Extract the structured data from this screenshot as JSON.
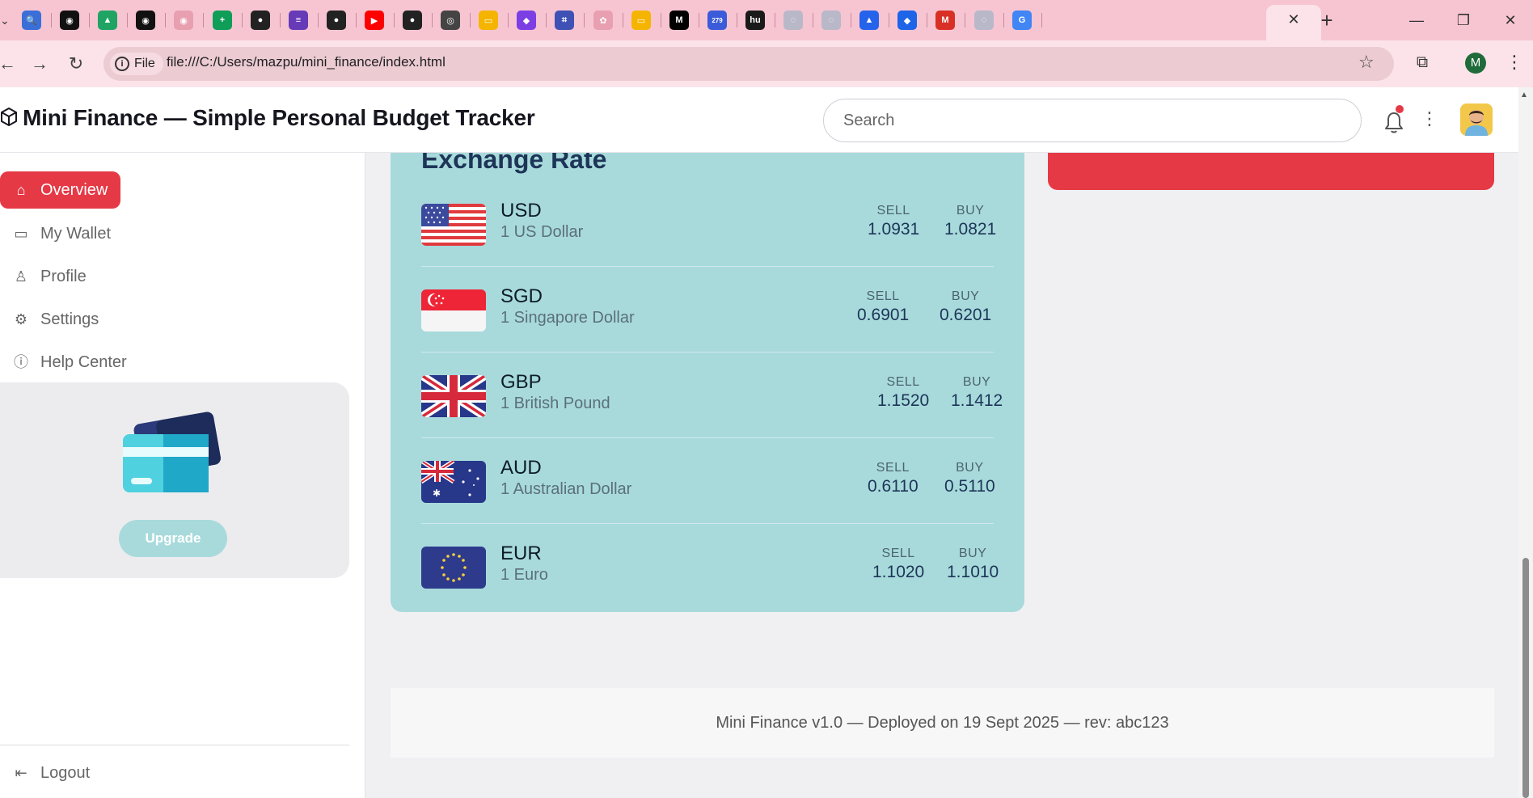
{
  "browser": {
    "tab_icons": [
      {
        "name": "search-tab-icon",
        "color": "#3a6fd8",
        "glyph": "🔍"
      },
      {
        "name": "perplexity-tab-icon",
        "color": "#111111",
        "glyph": "◉"
      },
      {
        "name": "drive-tab-icon",
        "color": "#1fa463",
        "glyph": "▲"
      },
      {
        "name": "perplexity2-tab-icon",
        "color": "#111111",
        "glyph": "◉"
      },
      {
        "name": "claude-tab-icon",
        "color": "#e8a0b0",
        "glyph": "◉"
      },
      {
        "name": "sheets-tab-icon",
        "color": "#0f9d58",
        "glyph": "+"
      },
      {
        "name": "github-tab-icon",
        "color": "#222222",
        "glyph": "●"
      },
      {
        "name": "forms-tab-icon",
        "color": "#673ab7",
        "glyph": "≡"
      },
      {
        "name": "github2-tab-icon",
        "color": "#222222",
        "glyph": "●"
      },
      {
        "name": "youtube-tab-icon",
        "color": "#ff0000",
        "glyph": "▶"
      },
      {
        "name": "github3-tab-icon",
        "color": "#222222",
        "glyph": "●"
      },
      {
        "name": "chrome-tab-icon",
        "color": "#444444",
        "glyph": "◎"
      },
      {
        "name": "slides-tab-icon",
        "color": "#f4b400",
        "glyph": "▭"
      },
      {
        "name": "copilot-tab-icon",
        "color": "#7b3fe4",
        "glyph": "◆"
      },
      {
        "name": "scan-tab-icon",
        "color": "#3f51b5",
        "glyph": "⌗"
      },
      {
        "name": "openai-tab-icon",
        "color": "#e8a0b0",
        "glyph": "✿"
      },
      {
        "name": "slides2-tab-icon",
        "color": "#f4b400",
        "glyph": "▭"
      },
      {
        "name": "medium-tab-icon",
        "color": "#000000",
        "glyph": "M"
      },
      {
        "name": "calendar-tab-icon",
        "color": "#3b5bd9",
        "glyph": "279"
      },
      {
        "name": "hu-tab-icon",
        "color": "#1a1a1a",
        "glyph": "hu"
      },
      {
        "name": "globe-tab-icon",
        "color": "#b8b8c8",
        "glyph": "◌"
      },
      {
        "name": "globe2-tab-icon",
        "color": "#b8b8c8",
        "glyph": "◌"
      },
      {
        "name": "atlassian-tab-icon",
        "color": "#2563eb",
        "glyph": "▲"
      },
      {
        "name": "jira-tab-icon",
        "color": "#1d64e8",
        "glyph": "◆"
      },
      {
        "name": "gmail-tab-icon",
        "color": "#d93025",
        "glyph": "M"
      },
      {
        "name": "globe3-tab-icon",
        "color": "#b8b8c8",
        "glyph": "◌"
      },
      {
        "name": "google-tab-icon",
        "color": "#4285f4",
        "glyph": "G"
      }
    ],
    "site_info_label": "File",
    "url": "file:///C:/Users/mazpu/mini_finance/index.html",
    "profile_initial": "M"
  },
  "header": {
    "title": "Mini Finance — Simple Personal Budget Tracker",
    "search_placeholder": "Search"
  },
  "sidebar": {
    "items": [
      {
        "label": "Overview",
        "icon": "home-icon",
        "active": true
      },
      {
        "label": "My Wallet",
        "icon": "wallet-icon",
        "active": false
      },
      {
        "label": "Profile",
        "icon": "user-icon",
        "active": false
      },
      {
        "label": "Settings",
        "icon": "gear-icon",
        "active": false
      },
      {
        "label": "Help Center",
        "icon": "help-icon",
        "active": false
      }
    ],
    "upgrade_label": "Upgrade",
    "logout_label": "Logout"
  },
  "exchange": {
    "title": "Exchange Rate",
    "sell_label": "SELL",
    "buy_label": "BUY",
    "rows": [
      {
        "code": "USD",
        "name": "1 US Dollar",
        "sell": "1.0931",
        "buy": "1.0821",
        "flag": "us-flag-icon"
      },
      {
        "code": "SGD",
        "name": "1 Singapore Dollar",
        "sell": "0.6901",
        "buy": "0.6201",
        "flag": "singapore-flag-icon"
      },
      {
        "code": "GBP",
        "name": "1 British Pound",
        "sell": "1.1520",
        "buy": "1.1412",
        "flag": "uk-flag-icon"
      },
      {
        "code": "AUD",
        "name": "1 Australian Dollar",
        "sell": "0.6110",
        "buy": "0.5110",
        "flag": "australia-flag-icon"
      },
      {
        "code": "EUR",
        "name": "1 Euro",
        "sell": "1.1020",
        "buy": "1.1010",
        "flag": "eu-flag-icon"
      }
    ]
  },
  "footer": {
    "text": "Mini Finance v1.0 — Deployed on 19 Sept 2025 — rev: abc123"
  },
  "colors": {
    "accent": "#e63946",
    "card_bg": "#a8dadc",
    "heading": "#1d3557",
    "tabstrip": "#f7c5d2"
  }
}
